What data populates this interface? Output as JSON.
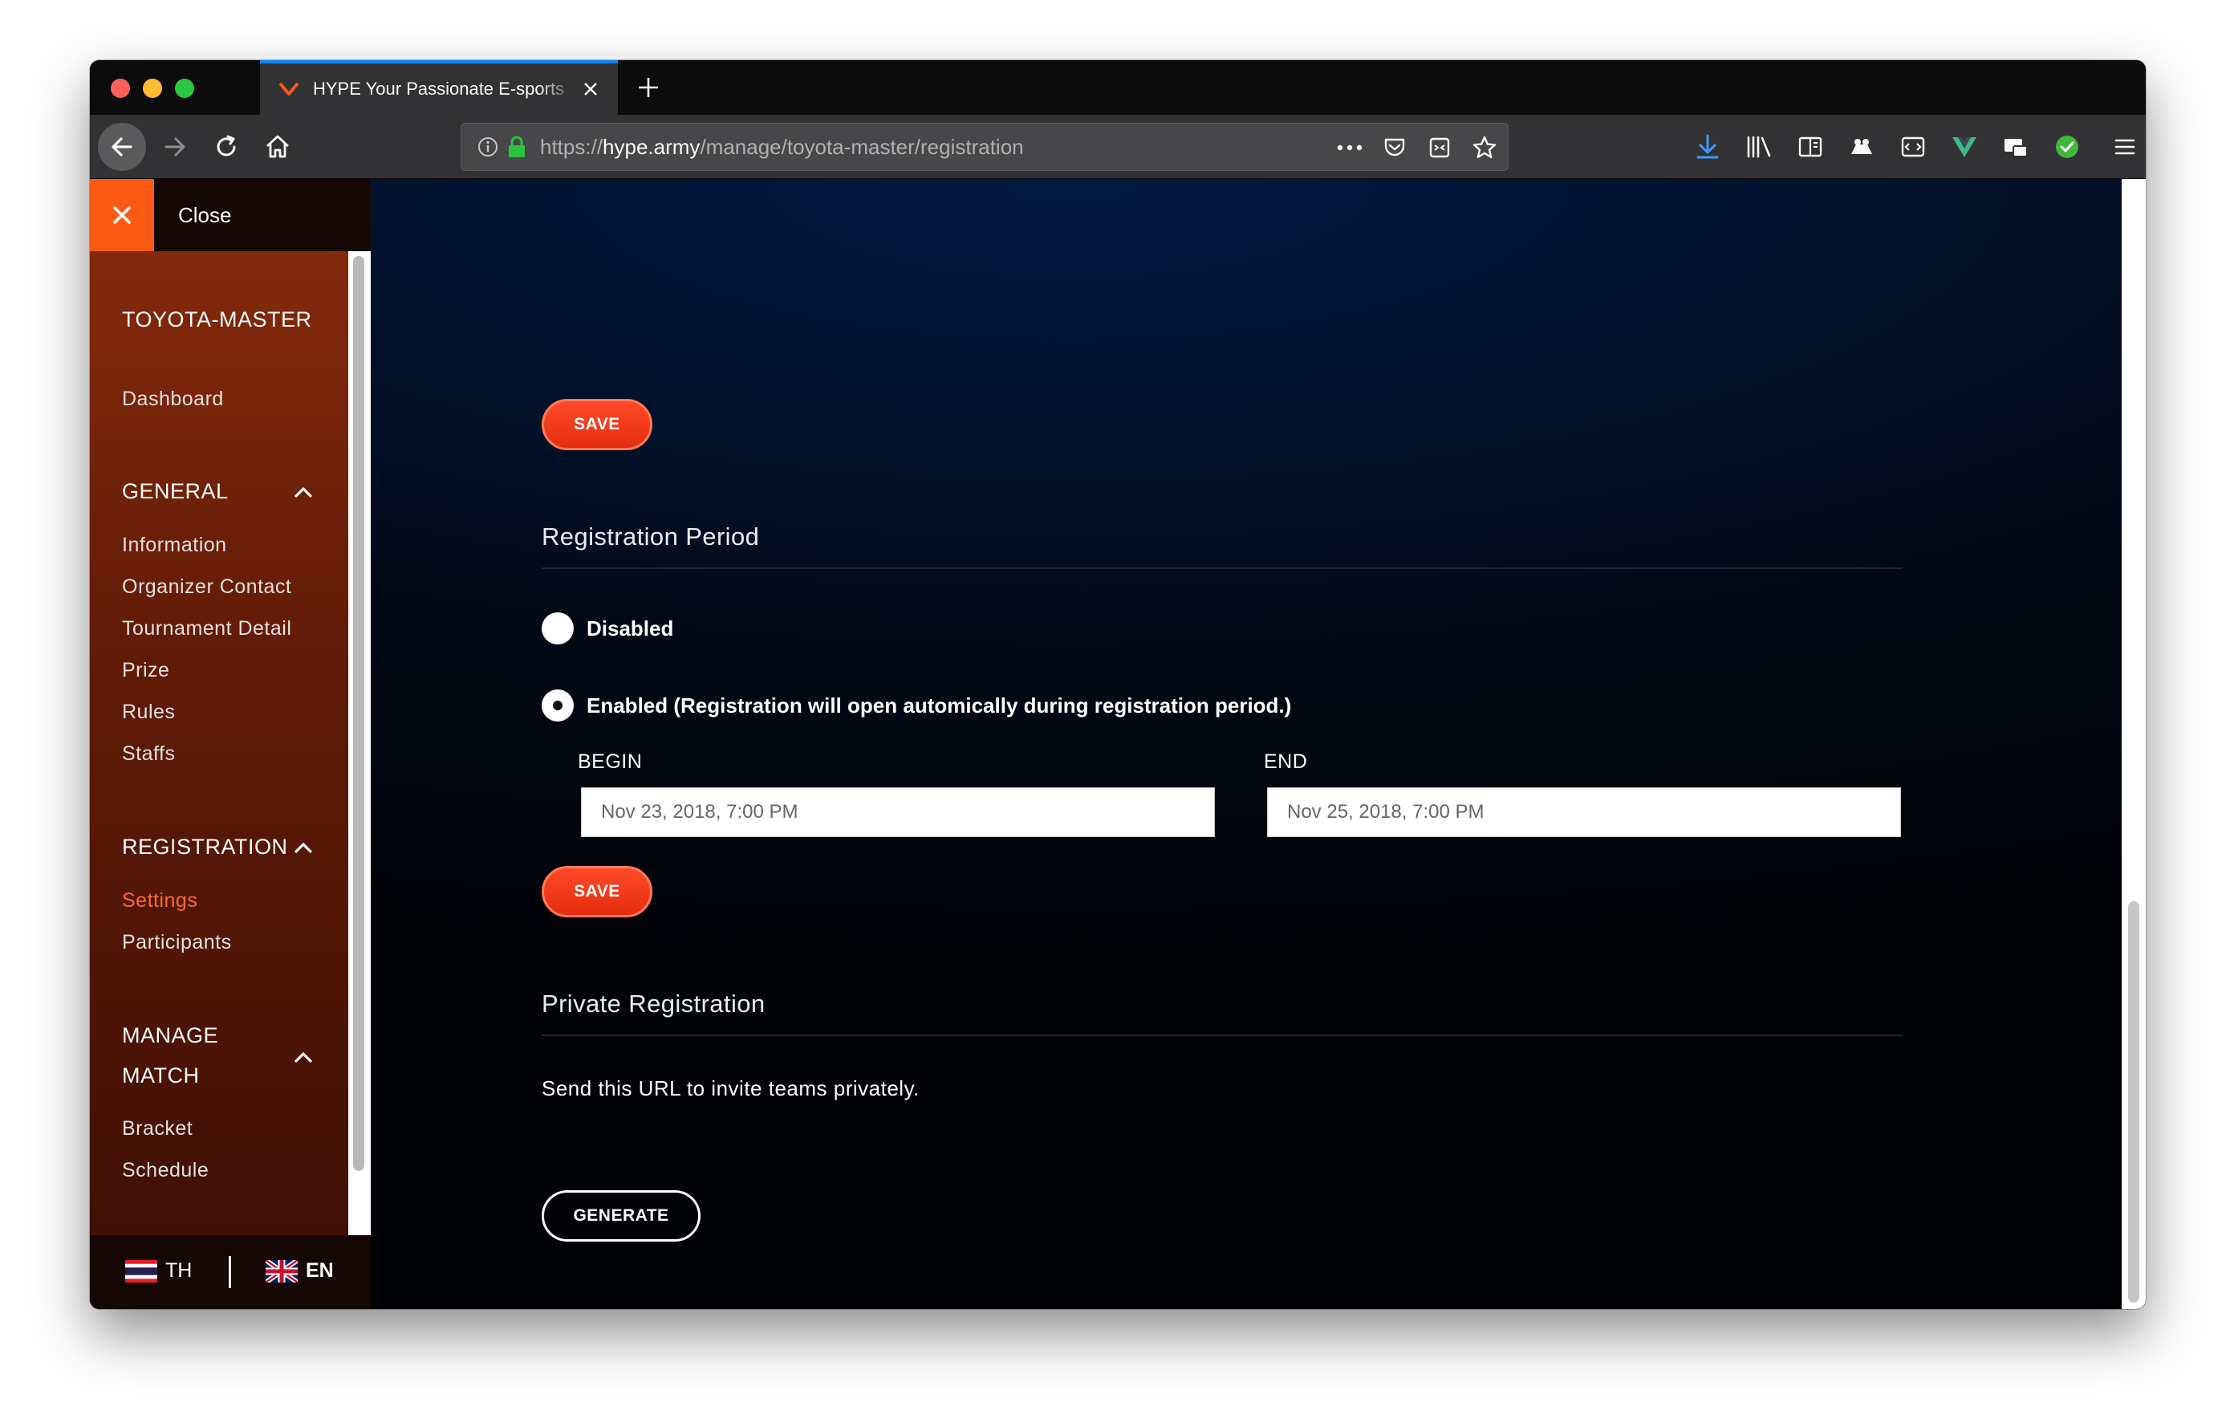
{
  "browser": {
    "tab_title": "HYPE Your Passionate E-sports",
    "url_prefix": "https://",
    "url_domain": "hype.army",
    "url_path": "/manage/toyota-master/registration"
  },
  "sidebar": {
    "close_label": "Close",
    "tournament_title": "TOYOTA-MASTER",
    "dashboard": "Dashboard",
    "sections": [
      {
        "title": "GENERAL",
        "items": [
          "Information",
          "Organizer Contact",
          "Tournament Detail",
          "Prize",
          "Rules",
          "Staffs"
        ]
      },
      {
        "title": "REGISTRATION",
        "items": [
          "Settings",
          "Participants"
        ]
      },
      {
        "title_line1": "MANAGE",
        "title_line2": "MATCH",
        "items": [
          "Bracket",
          "Schedule"
        ]
      }
    ],
    "active_item": "Settings",
    "languages": [
      {
        "code": "TH"
      },
      {
        "code": "EN"
      }
    ]
  },
  "main": {
    "save_label": "SAVE",
    "registration_period": {
      "heading": "Registration Period",
      "option_disabled": "Disabled",
      "option_enabled": "Enabled (Registration will open automically during registration period.)",
      "selected": "enabled",
      "begin_label": "BEGIN",
      "begin_value": "Nov 23, 2018, 7:00 PM",
      "end_label": "END",
      "end_value": "Nov 25, 2018, 7:00 PM"
    },
    "private_registration": {
      "heading": "Private Registration",
      "description": "Send this URL to invite teams privately.",
      "generate_label": "GENERATE"
    }
  },
  "colors": {
    "accent_orange": "#fb5a14",
    "active_link": "#ff6a32",
    "save_button": "#e42d0e",
    "browser_accent": "#0a84ff"
  }
}
